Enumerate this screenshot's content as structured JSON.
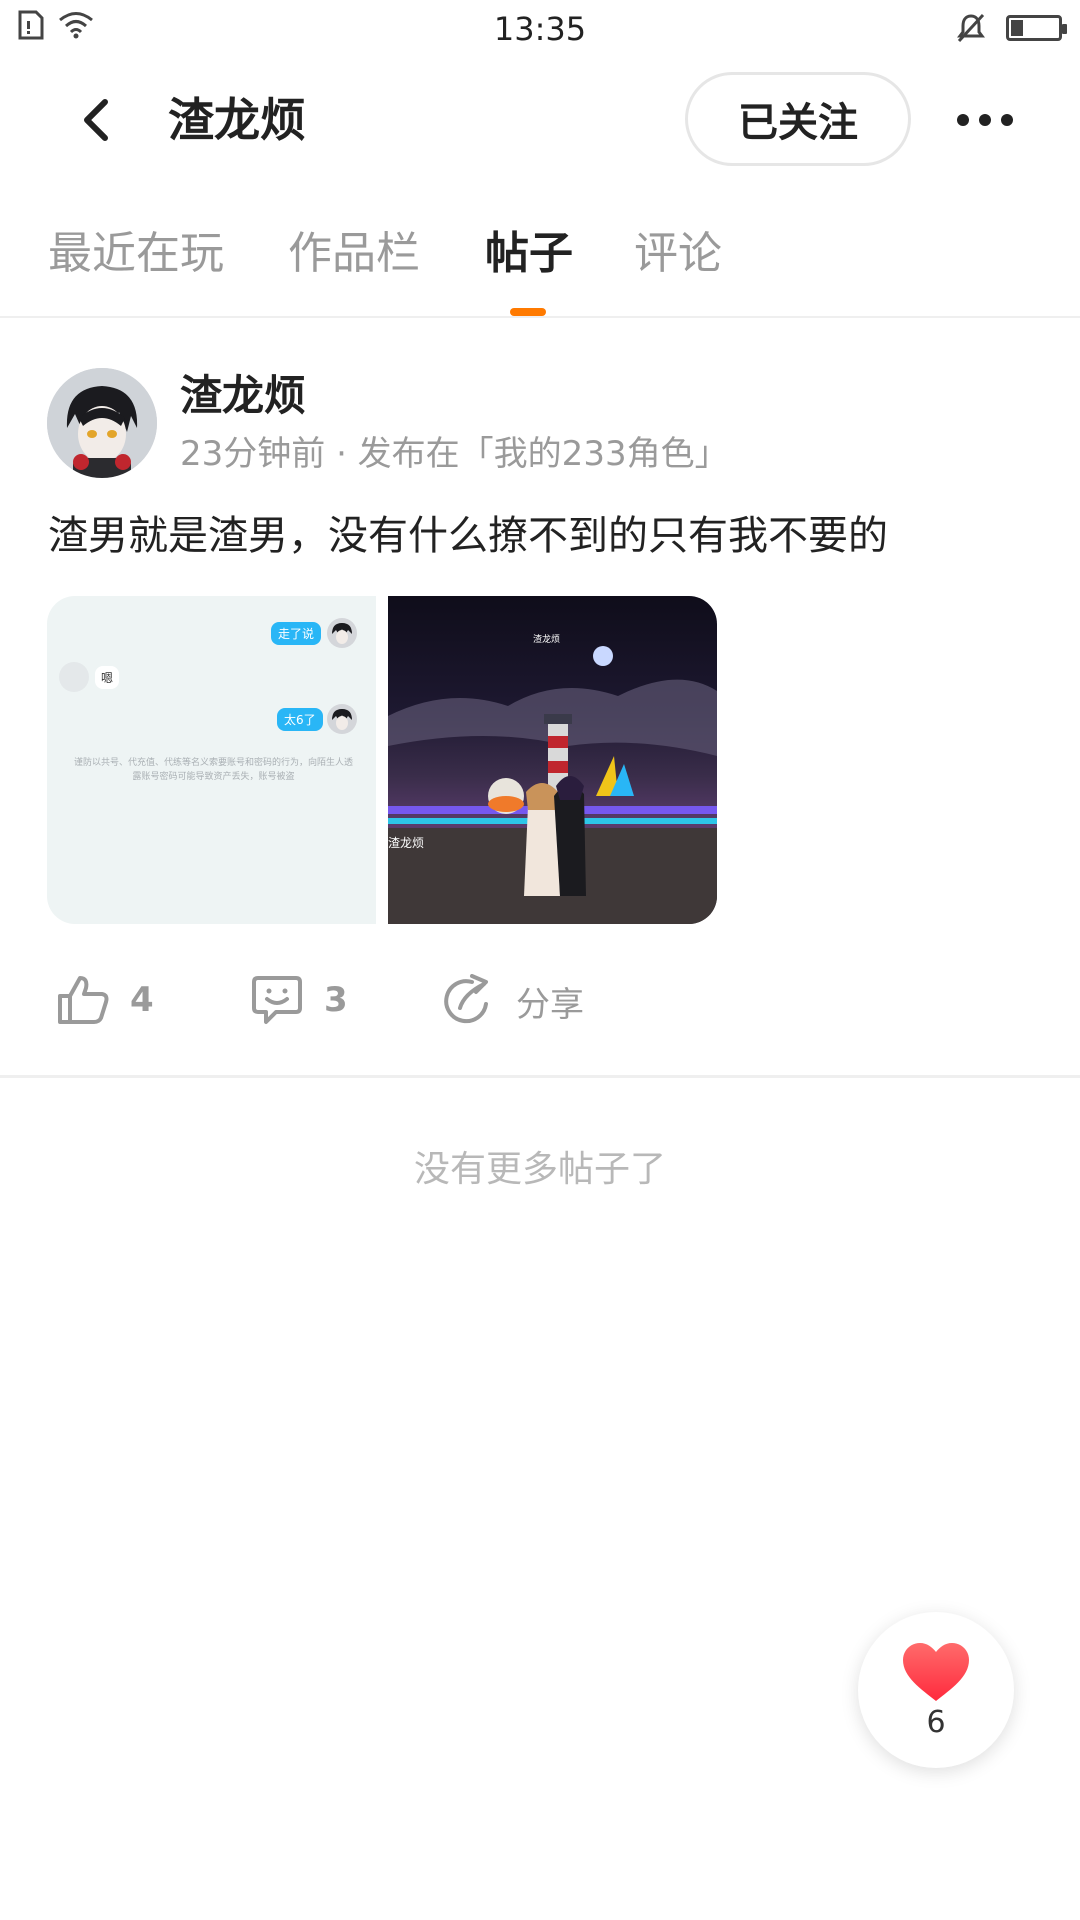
{
  "status_bar": {
    "time": "13:35",
    "battery_level": 0.25
  },
  "header": {
    "title": "渣龙烦",
    "follow_label": "已关注"
  },
  "tabs": [
    {
      "label": "最近在玩",
      "active": false
    },
    {
      "label": "作品栏",
      "active": false
    },
    {
      "label": "帖子",
      "active": true
    },
    {
      "label": "评论",
      "active": false
    }
  ],
  "post": {
    "author": "渣龙烦",
    "meta": "23分钟前 · 发布在「我的233角色」",
    "text": "渣男就是渣男，没有什么撩不到的只有我不要的",
    "images": [
      {
        "chat_bubbles": [
          "走了说",
          "嗯",
          "太6了"
        ],
        "notice": "谨防以共号、代充值、代练等名义索要账号和密码的行为，向陌生人透露账号密码可能导致资产丢失，账号被盗"
      },
      {
        "player_name": "渣龙烦"
      }
    ],
    "likes": "4",
    "comments": "3",
    "share_label": "分享"
  },
  "footer_text": "没有更多帖子了",
  "fab": {
    "count": "6"
  },
  "colors": {
    "accent": "#ff7a00",
    "like_red": "#ff3b4b",
    "muted": "#9a9a9a",
    "chat_bubble": "#29b6f6"
  }
}
